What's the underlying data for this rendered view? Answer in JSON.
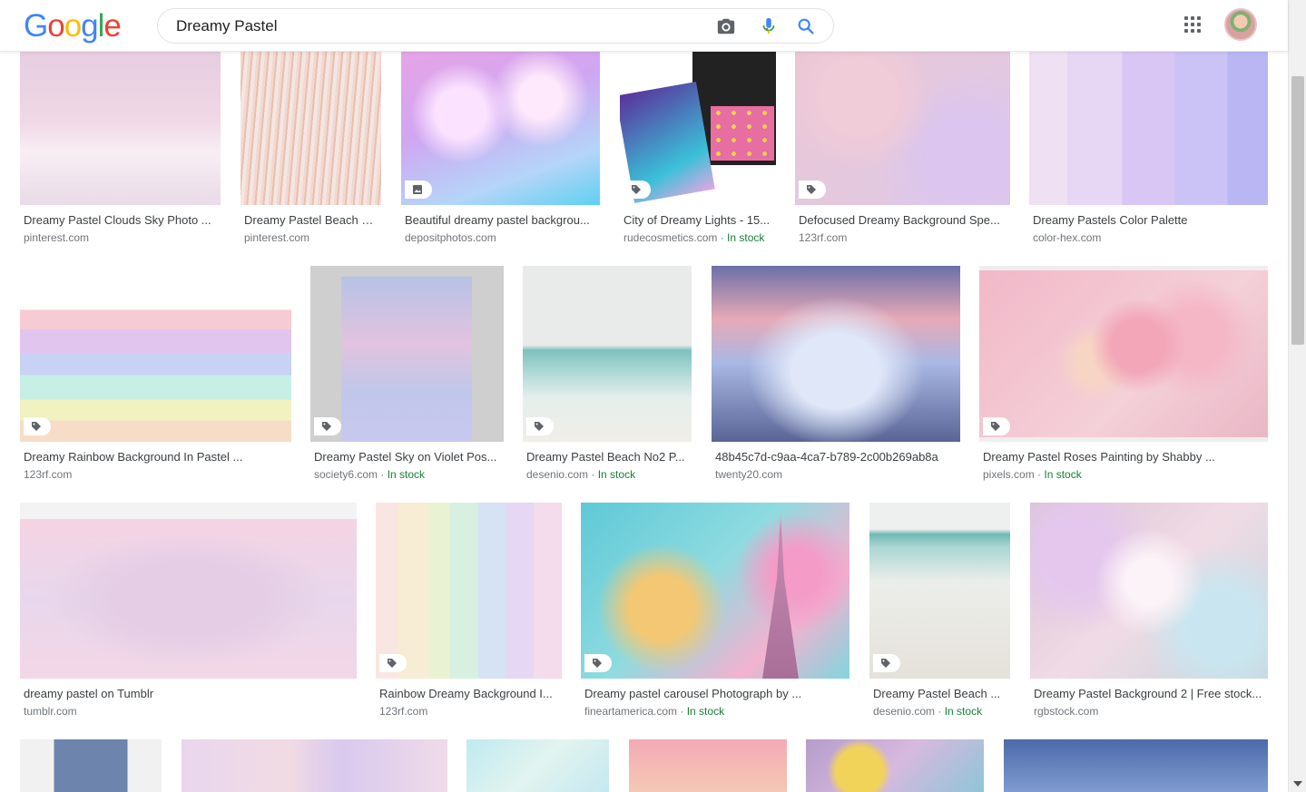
{
  "header": {
    "logo": [
      "G",
      "o",
      "o",
      "g",
      "l",
      "e"
    ],
    "logo_colors": [
      "#4285F4",
      "#EA4335",
      "#FBBC05",
      "#4285F4",
      "#34A853",
      "#EA4335"
    ],
    "search_value": "Dreamy Pastel"
  },
  "rows": [
    [
      {
        "caption": "Dreamy Pastel Clouds Sky Photo ...",
        "source": "pinterest.com",
        "stock": ""
      },
      {
        "caption": "Dreamy Pastel Beach G...",
        "source": "pinterest.com",
        "stock": ""
      },
      {
        "caption": "Beautiful dreamy pastel backgrou...",
        "source": "depositphotos.com",
        "stock": ""
      },
      {
        "caption": "City of Dreamy Lights - 15...",
        "source": "rudecosmetics.com",
        "stock": "In stock"
      },
      {
        "caption": "Defocused Dreamy Background Spe...",
        "source": "123rf.com",
        "stock": ""
      },
      {
        "caption": "Dreamy Pastels Color Palette",
        "source": "color-hex.com",
        "stock": ""
      }
    ],
    [
      {
        "caption": "Dreamy Rainbow Background In Pastel ...",
        "source": "123rf.com",
        "stock": ""
      },
      {
        "caption": "Dreamy Pastel Sky on Violet Pos...",
        "source": "society6.com",
        "stock": "In stock"
      },
      {
        "caption": "Dreamy Pastel Beach No2 P...",
        "source": "desenio.com",
        "stock": "In stock"
      },
      {
        "caption": "48b45c7d-c9aa-4ca7-b789-2c00b269ab8a",
        "source": "twenty20.com",
        "stock": ""
      },
      {
        "caption": "Dreamy Pastel Roses Painting by Shabby ...",
        "source": "pixels.com",
        "stock": "In stock"
      }
    ],
    [
      {
        "caption": "dreamy pastel on Tumblr",
        "source": "tumblr.com",
        "stock": ""
      },
      {
        "caption": "Rainbow Dreamy Background I...",
        "source": "123rf.com",
        "stock": ""
      },
      {
        "caption": "Dreamy pastel carousel Photograph by ...",
        "source": "fineartamerica.com",
        "stock": "In stock"
      },
      {
        "caption": "Dreamy Pastel Beach ...",
        "source": "desenio.com",
        "stock": "In stock"
      },
      {
        "caption": "Dreamy Pastel Background 2 | Free stock...",
        "source": "rgbstock.com",
        "stock": ""
      }
    ]
  ],
  "stock_separator": " · "
}
